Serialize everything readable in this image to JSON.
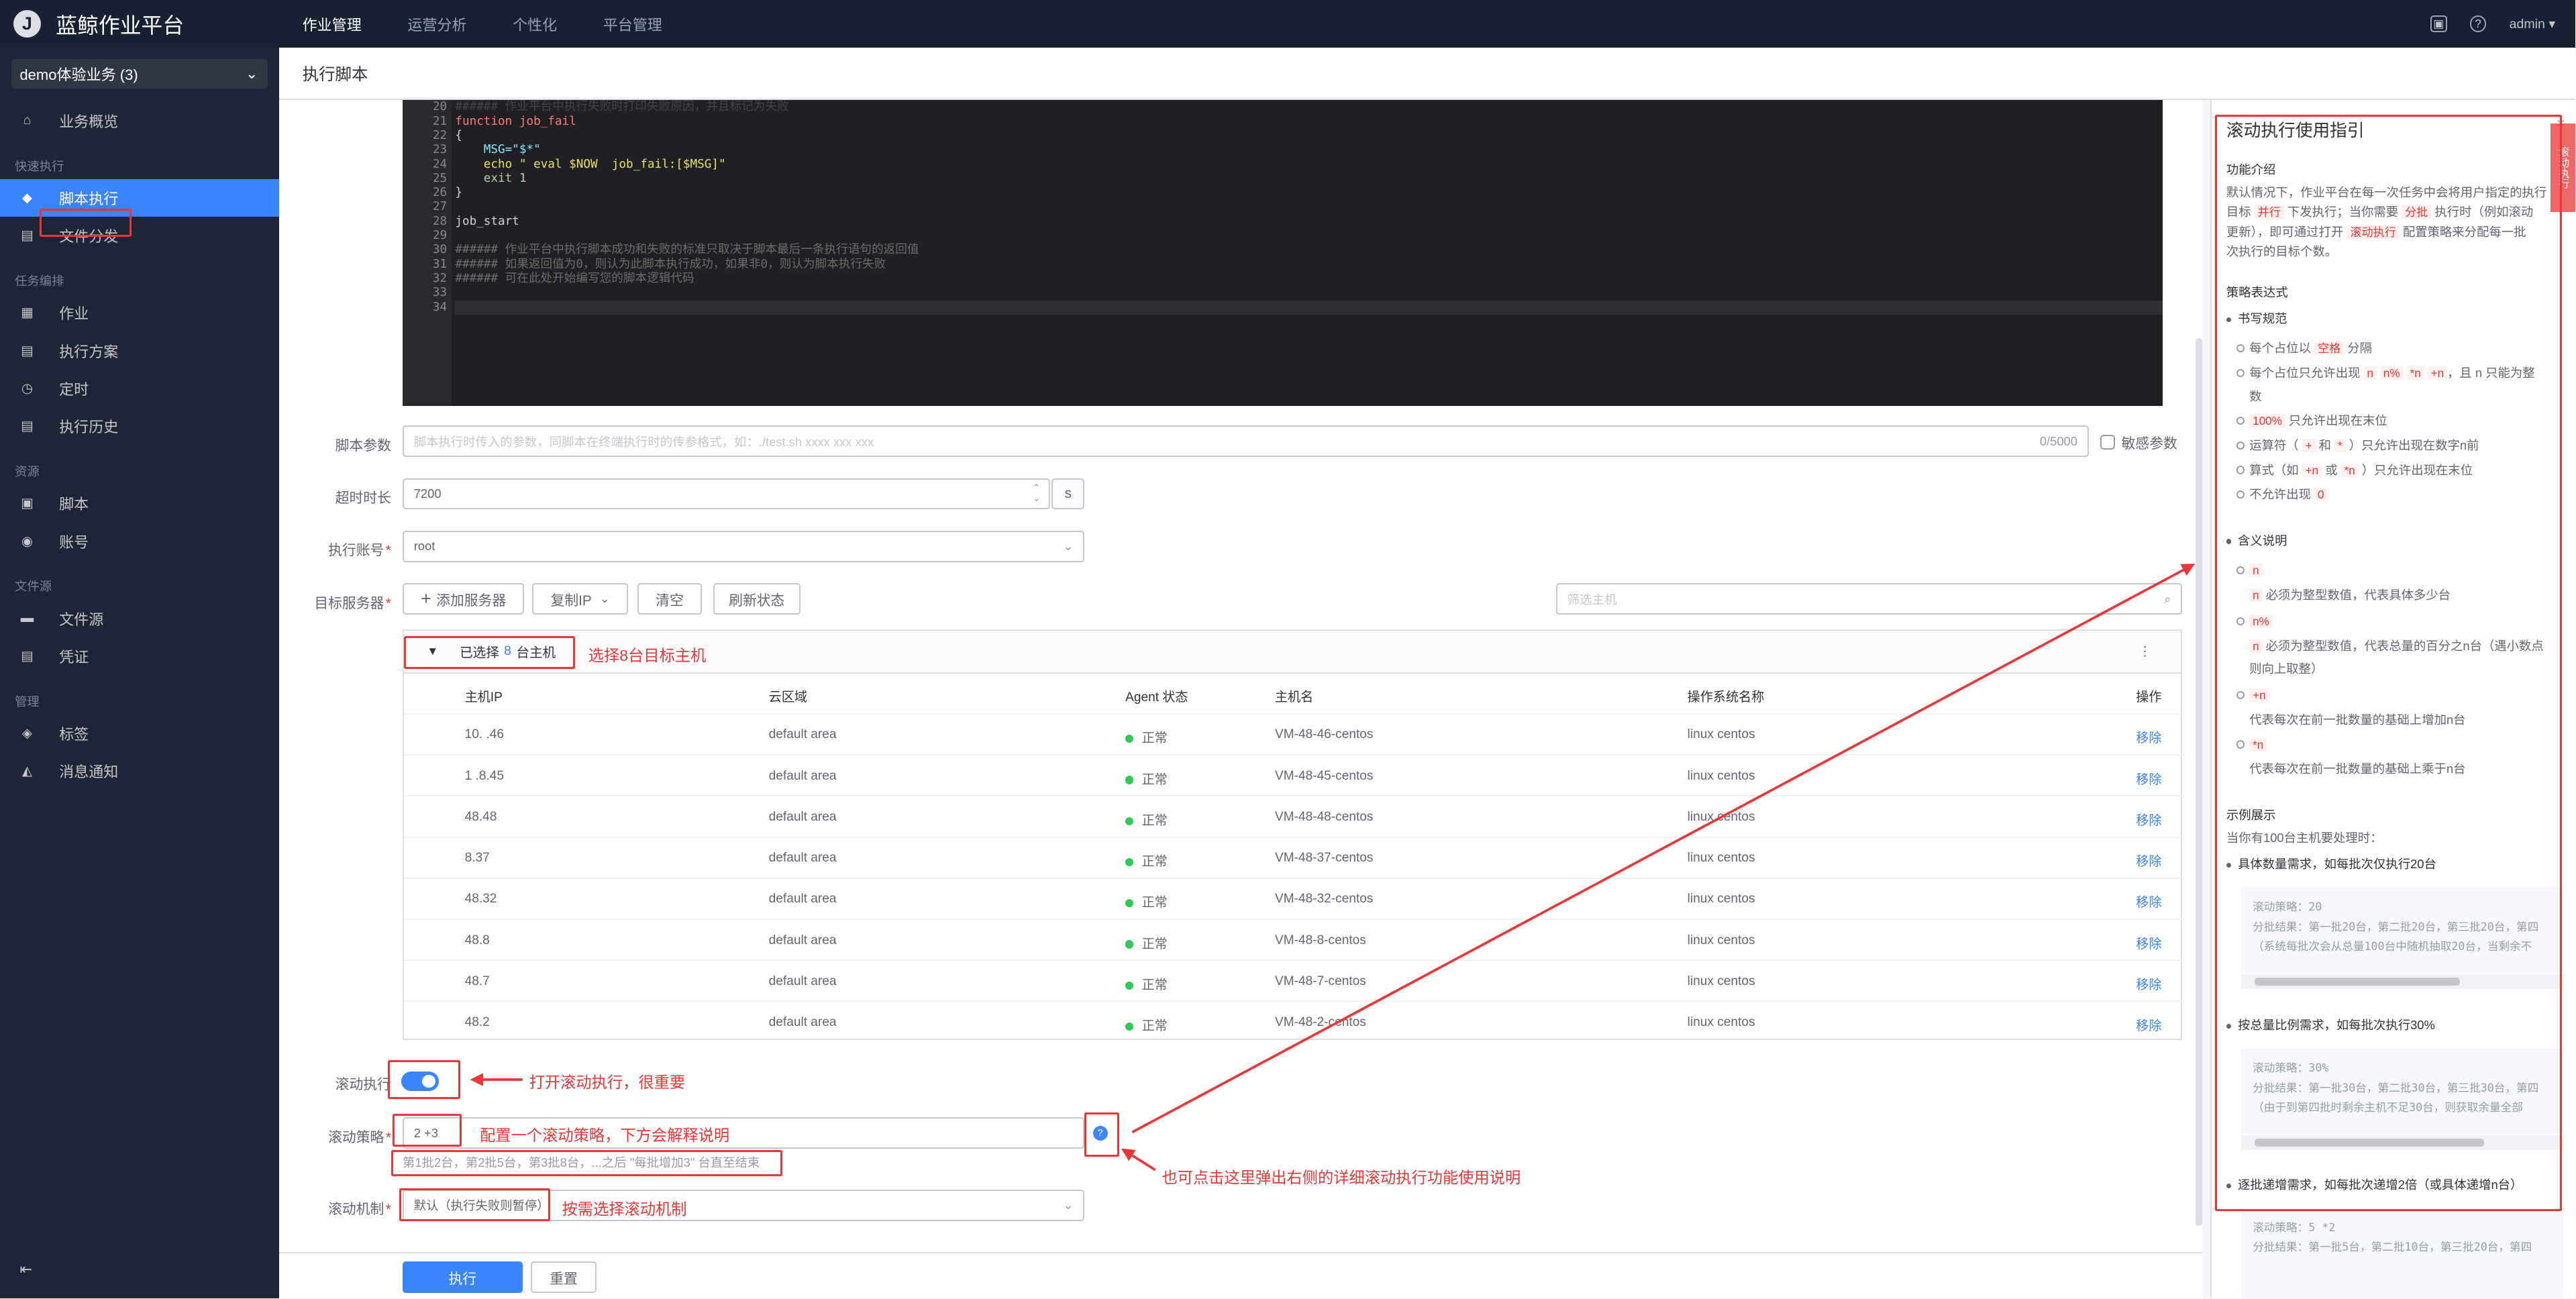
{
  "app": {
    "title": "蓝鲸作业平台",
    "logo_letter": "J"
  },
  "topnav": [
    {
      "label": "作业管理",
      "active": true
    },
    {
      "label": "运营分析",
      "active": false
    },
    {
      "label": "个性化",
      "active": false
    },
    {
      "label": "平台管理",
      "active": false
    }
  ],
  "user": {
    "name": "admin"
  },
  "business": {
    "selected": "demo体验业务 (3)"
  },
  "sidebar": {
    "overview": "业务概览",
    "group_quick": "快速执行",
    "script_exec": "脚本执行",
    "file_dist": "文件分发",
    "group_task": "任务编排",
    "job": "作业",
    "plan": "执行方案",
    "cron": "定时",
    "history": "执行历史",
    "group_res": "资源",
    "script": "脚本",
    "account": "账号",
    "group_file": "文件源",
    "file_source": "文件源",
    "ticket": "凭证",
    "group_manage": "管理",
    "tag": "标签",
    "notify": "消息通知"
  },
  "page": {
    "title": "执行脚本"
  },
  "editor": {
    "line_numbers": [
      "20",
      "21",
      "22",
      "23",
      "24",
      "25",
      "26",
      "27",
      "28",
      "29",
      "30",
      "31",
      "32",
      "33",
      "34"
    ],
    "lines": [
      "###### 作业平台中执行失败时打印失败原因，并且标记为失败",
      "function job_fail",
      "{",
      "    MSG=\"$*\"",
      "    echo \" eval $NOW  job_fail:[$MSG]\"",
      "    exit 1",
      "}",
      "",
      "job_start",
      "",
      "###### 作业平台中执行脚本成功和失败的标准只取决于脚本最后一条执行语句的返回值",
      "###### 如果返回值为0，则认为此脚本执行成功，如果非0，则认为脚本执行失败",
      "###### 可在此处开始编写您的脚本逻辑代码",
      "",
      ""
    ]
  },
  "form": {
    "params_label": "脚本参数",
    "params_placeholder": "脚本执行时传入的参数，同脚本在终端执行时的传参格式，如：./test.sh xxxx xxx xxx",
    "params_count": "0/5000",
    "sensitive_label": "敏感参数",
    "timeout_label": "超时时长",
    "timeout_value": "7200",
    "timeout_unit": "s",
    "account_label": "执行账号",
    "account_value": "root",
    "target_label": "目标服务器",
    "add_server": "添加服务器",
    "copy_ip": "复制IP",
    "clear": "清空",
    "refresh": "刷新状态",
    "filter_placeholder": "筛选主机",
    "selected_prefix": "已选择",
    "selected_count": "8",
    "selected_suffix": "台主机",
    "rolling_label": "滚动执行",
    "strategy_label": "滚动策略",
    "strategy_value": "2 +3",
    "strategy_hint": "第1批2台，第2批5台，第3批8台，...之后 \"每批增加3\" 台直至结束",
    "mechanism_label": "滚动机制",
    "mechanism_value": "默认（执行失败则暂停）",
    "execute": "执行",
    "reset": "重置"
  },
  "table": {
    "headers": [
      "主机IP",
      "云区域",
      "Agent 状态",
      "主机名",
      "操作系统名称",
      "操作"
    ],
    "rows": [
      {
        "ip": "10.  .46",
        "area": "default area",
        "status": "正常",
        "host": "VM-48-46-centos",
        "os": "linux centos",
        "op": "移除"
      },
      {
        "ip": "1  .8.45",
        "area": "default area",
        "status": "正常",
        "host": "VM-48-45-centos",
        "os": "linux centos",
        "op": "移除"
      },
      {
        "ip": "  48.48",
        "area": "default area",
        "status": "正常",
        "host": "VM-48-48-centos",
        "os": "linux centos",
        "op": "移除"
      },
      {
        "ip": "  8.37",
        "area": "default area",
        "status": "正常",
        "host": "VM-48-37-centos",
        "os": "linux centos",
        "op": "移除"
      },
      {
        "ip": "  48.32",
        "area": "default area",
        "status": "正常",
        "host": "VM-48-32-centos",
        "os": "linux centos",
        "op": "移除"
      },
      {
        "ip": "  48.8",
        "area": "default area",
        "status": "正常",
        "host": "VM-48-8-centos",
        "os": "linux centos",
        "op": "移除"
      },
      {
        "ip": "  48.7",
        "area": "default area",
        "status": "正常",
        "host": "VM-48-7-centos",
        "os": "linux centos",
        "op": "移除"
      },
      {
        "ip": "  48.2",
        "area": "default area",
        "status": "正常",
        "host": "VM-48-2-centos",
        "os": "linux centos",
        "op": "移除"
      }
    ]
  },
  "annotations": {
    "select_hosts": "选择8台目标主机",
    "open_rolling": "打开滚动执行，很重要",
    "config_strategy": "配置一个滚动策略，下方会解释说明",
    "click_help": "也可点击这里弹出右侧的详细滚动执行功能使用说明",
    "mechanism": "按需选择滚动机制"
  },
  "panel": {
    "title": "滚动执行使用指引",
    "intro_title": "功能介绍",
    "intro_1": "默认情况下，作业平台在每一次任务中会将用户指定的执行",
    "intro_2a": "目标",
    "intro_2b": "并行",
    "intro_2c": "下发执行；当你需要",
    "intro_2d": "分批",
    "intro_2e": "执行时（例如滚动",
    "intro_3a": "更新），即可通过打开",
    "intro_3b": "滚动执行",
    "intro_3c": "配置策略来分配每一批",
    "intro_4": "次执行的目标个数。",
    "expr_title": "策略表达式",
    "rule_title": "书写规范",
    "r1a": "每个占位以",
    "r1b": "空格",
    "r1c": "分隔",
    "r2a": "每个占位只允许出现",
    "r2t1": "n",
    "r2t2": "n%",
    "r2t3": "*n",
    "r2t4": "+n",
    "r2b": "，且 n 只能为整",
    "r2c": "数",
    "r3t": "100%",
    "r3": "只允许出现在末位",
    "r4a": "运算符（",
    "r4t1": "+",
    "r4b": "和",
    "r4t2": "*",
    "r4c": "）只允许出现在数字n前",
    "r5a": "算式（如",
    "r5t1": "+n",
    "r5b": "或",
    "r5t2": "*n",
    "r5c": "）只允许出现在末位",
    "r6": "不允许出现",
    "r6t": "0",
    "meaning_title": "含义说明",
    "m1t": "n",
    "m1": "必须为整型数值，代表具体多少台",
    "m2t": "n%",
    "m2a": "必须为整型数值，代表总量的百分之n台（遇小数点",
    "m2b": "则向上取整）",
    "m3t": "+n",
    "m3": "代表每次在前一批数量的基础上增加n台",
    "m4t": "*n",
    "m4": "代表每次在前一批数量的基础上乘于n台",
    "example_title": "示例展示",
    "example_sub": "当你有100台主机要处理时：",
    "ex1_title": "具体数量需求，如每批次仅执行20台",
    "ex1_l1": "滚动策略：20",
    "ex1_l2": "分批结果：第一批20台，第二批20台，第三批20台，第四",
    "ex1_l3": "（系统每批次会从总量100台中随机抽取20台，当剩余不",
    "ex2_title": "按总量比例需求，如每批次执行30%",
    "ex2_l1": "滚动策略：30%",
    "ex2_l2": "分批结果：第一批30台，第二批30台，第三批30台，第四",
    "ex2_l3": "（由于到第四批时剩余主机不足30台，则获取余量全部",
    "ex3_title": "逐批递增需求，如每批次递增2倍（或具体递增n台）",
    "ex3_l1": "滚动策略：5 *2",
    "ex3_l2": "分批结果：第一批5台，第二批10台，第三批20台，第四",
    "side_tab": "滚动执行"
  }
}
